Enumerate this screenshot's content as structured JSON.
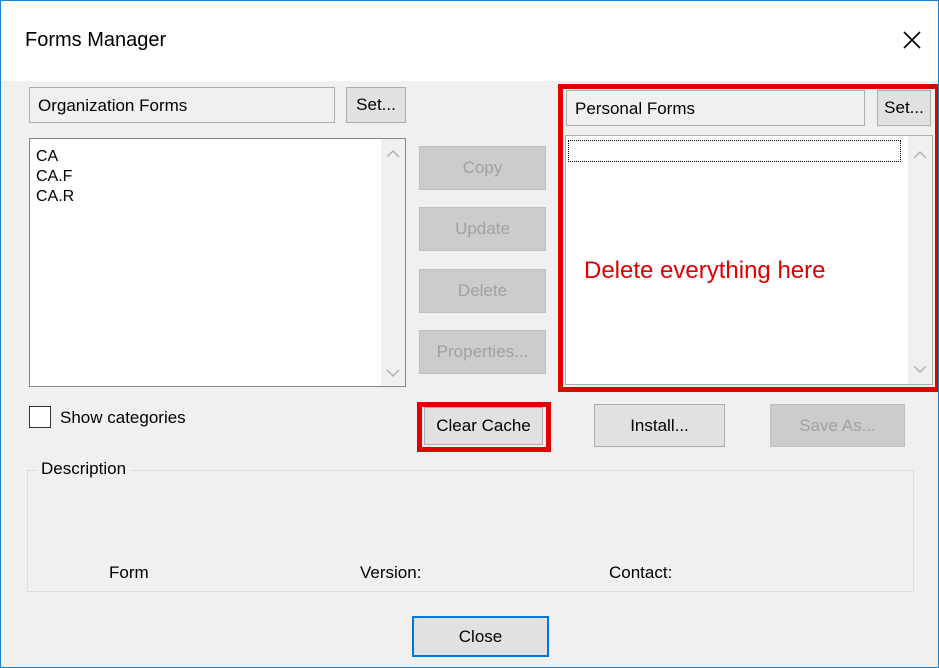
{
  "window": {
    "title": "Forms Manager",
    "close_icon": "close-icon"
  },
  "org": {
    "label": "Organization Forms",
    "set_label": "Set...",
    "items": [
      "CA",
      "CA.F",
      "CA.R"
    ]
  },
  "personal": {
    "label": "Personal Forms",
    "set_label": "Set...",
    "items": []
  },
  "actions": {
    "copy": "Copy",
    "update": "Update",
    "delete": "Delete",
    "properties": "Properties...",
    "clear_cache": "Clear Cache",
    "install": "Install...",
    "save_as": "Save As..."
  },
  "options": {
    "show_categories": "Show categories",
    "show_categories_checked": false
  },
  "description": {
    "legend": "Description",
    "form_label": "Form",
    "version_label": "Version:",
    "contact_label": "Contact:"
  },
  "footer": {
    "close_label": "Close"
  },
  "annotations": {
    "note": "Delete everything here",
    "highlight_color": "#e00000"
  },
  "colors": {
    "window_border": "#1883d7",
    "dialog_bg": "#f0f0f0",
    "default_button_border": "#0078d7"
  }
}
